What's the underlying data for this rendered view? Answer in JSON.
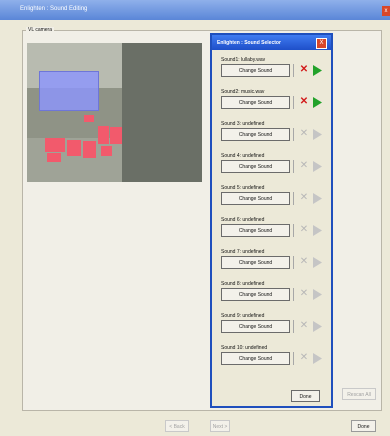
{
  "app": {
    "title": "Enlighten : Sound Editing",
    "close_label": "x"
  },
  "main": {
    "group_label": "VL camera"
  },
  "selector": {
    "title": "Enlighten : Sound Selector",
    "close_label": "X",
    "change_label": "Change Sound",
    "done_label": "Done",
    "sounds": [
      {
        "label": "Sound1: lullaby.wav",
        "enabled": true
      },
      {
        "label": "Sound2: music.wav",
        "enabled": true
      },
      {
        "label": "Sound 3: undefined",
        "enabled": false
      },
      {
        "label": "Sound 4: undefined",
        "enabled": false
      },
      {
        "label": "Sound 5: undefined",
        "enabled": false
      },
      {
        "label": "Sound 6: undefined",
        "enabled": false
      },
      {
        "label": "Sound 7: undefined",
        "enabled": false
      },
      {
        "label": "Sound 8: undefined",
        "enabled": false
      },
      {
        "label": "Sound 9: undefined",
        "enabled": false
      },
      {
        "label": "Sound 10: undefined",
        "enabled": false
      }
    ]
  },
  "footer": {
    "back": "< Back",
    "next": "Next >",
    "done": "Done",
    "rescan": "Rescan All"
  }
}
